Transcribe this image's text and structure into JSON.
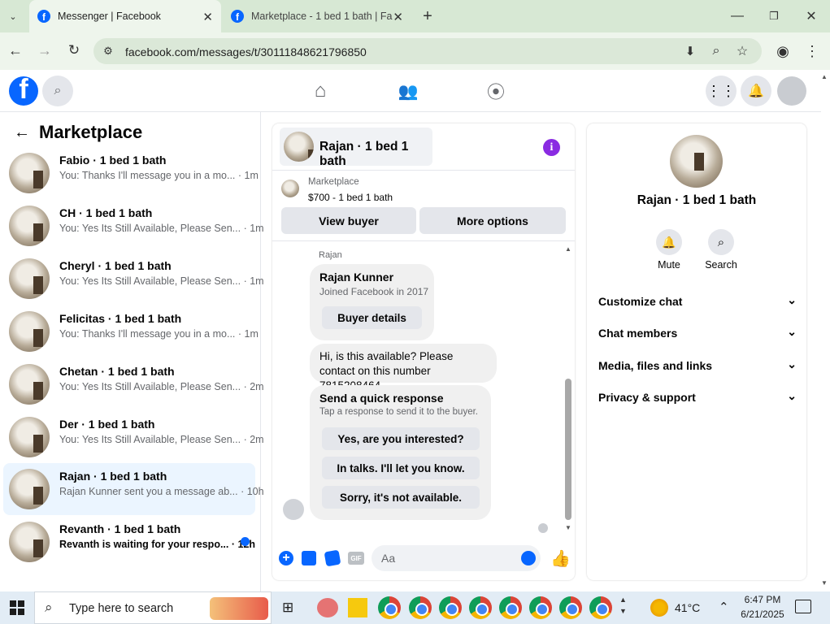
{
  "browser": {
    "tabs": [
      {
        "title": "Messenger | Facebook"
      },
      {
        "title": "Marketplace - 1 bed 1 bath | Fa"
      }
    ],
    "url": "facebook.com/messages/t/30111848621796850"
  },
  "sidebar": {
    "title": "Marketplace",
    "threads": [
      {
        "name": "Fabio · 1 bed 1 bath",
        "preview": "You: Thanks I'll message you in a mo...",
        "time": "· 1m"
      },
      {
        "name": "CH · 1 bed 1 bath",
        "preview": "You: Yes Its Still Available, Please Sen...",
        "time": "· 1m"
      },
      {
        "name": "Cheryl · 1 bed 1 bath",
        "preview": "You: Yes Its Still Available, Please Sen...",
        "time": "· 1m"
      },
      {
        "name": "Felicitas · 1 bed 1 bath",
        "preview": "You: Thanks I'll message you in a mo...",
        "time": "· 1m"
      },
      {
        "name": "Chetan · 1 bed 1 bath",
        "preview": "You: Yes Its Still Available, Please Sen...",
        "time": "· 2m"
      },
      {
        "name": "Der · 1 bed 1 bath",
        "preview": "You: Yes Its Still Available, Please Sen...",
        "time": "· 2m"
      },
      {
        "name": "Rajan · 1 bed 1 bath",
        "preview": "Rajan Kunner sent you a message ab...",
        "time": "· 10h"
      },
      {
        "name": "Revanth · 1 bed 1 bath",
        "preview": "Revanth is waiting for your respo...",
        "time": "· 12h"
      }
    ]
  },
  "chat": {
    "header_title": "Rajan · 1 bed 1 bath",
    "listing_source": "Marketplace",
    "listing_title": "$700 - 1 bed 1 bath",
    "view_buyer": "View buyer",
    "more_options": "More options",
    "sender_label": "Rajan",
    "profile_name": "Rajan Kunner",
    "profile_joined": "Joined Facebook in 2017",
    "buyer_details": "Buyer details",
    "message": "Hi, is this available? Please contact on this number 7815208464",
    "quick_title": "Send a quick response",
    "quick_sub": "Tap a response to send it to the buyer.",
    "quick_replies": [
      "Yes, are you interested?",
      "In talks. I'll let you know.",
      "Sorry, it's not available."
    ],
    "composer_placeholder": "Aa"
  },
  "info": {
    "name": "Rajan · 1 bed 1 bath",
    "mute": "Mute",
    "search": "Search",
    "sections": [
      "Customize chat",
      "Chat members",
      "Media, files and links",
      "Privacy & support"
    ]
  },
  "taskbar": {
    "search_placeholder": "Type here to search",
    "weather": "41°C",
    "time": "6:47 PM",
    "date": "6/21/2025"
  },
  "colors": {
    "brand": "#0866ff",
    "info_icon": "#8a2be2"
  }
}
